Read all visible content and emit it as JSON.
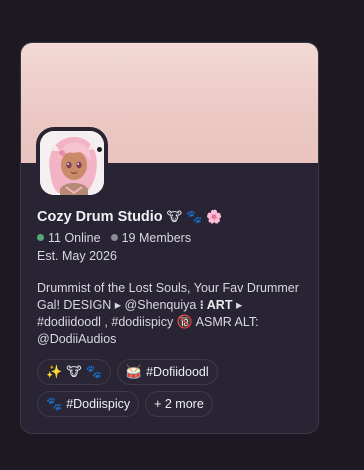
{
  "server": {
    "name": "Cozy Drum Studio",
    "title_emojis": [
      "🐮",
      "🐾",
      "🌸"
    ],
    "online_count": "11 Online",
    "member_count": "19 Members",
    "established": "Est. May 2026",
    "description": {
      "part1": "Drummist of the Lost Souls, Your Fav Drummer Gal! DESIGN ▸ @Shenquiya ",
      "bold_part": "⁝ ART",
      "part2": " ▸ #dodiidoodl , #dodiispicy ",
      "emoji": "🔞",
      "part3": " ASMR ALT: @DodiiAudios"
    }
  },
  "tags": [
    {
      "emoji": "✨",
      "extra": "🐮 🐾",
      "label": ""
    },
    {
      "emoji": "🥁",
      "label": "#Dofiidoodl"
    },
    {
      "emoji": "🐾",
      "label": "#Dodiispicy"
    },
    {
      "emoji": "",
      "label": "+ 2 more"
    }
  ],
  "colors": {
    "background": "#1c1923",
    "card": "#292433",
    "banner": "#ecc9c4",
    "online_dot": "#57a877",
    "members_dot": "#8d8a96"
  }
}
